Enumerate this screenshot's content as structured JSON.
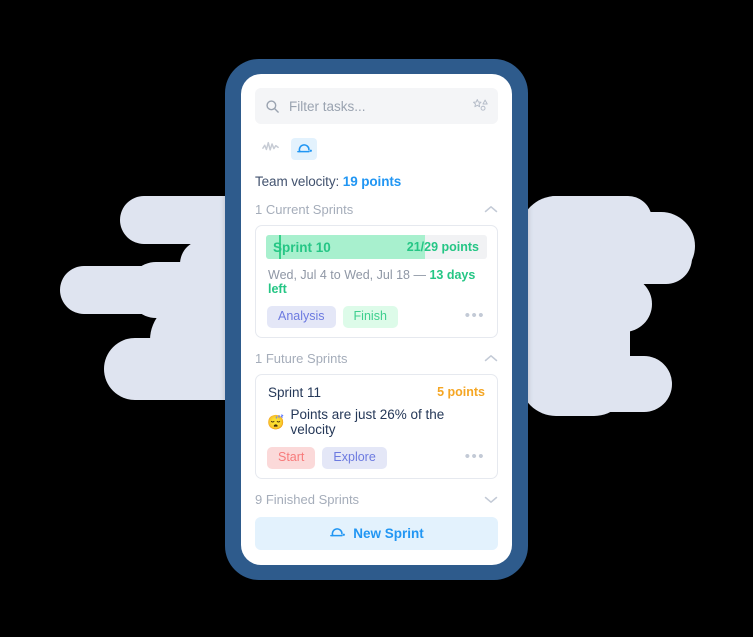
{
  "theme": {
    "frame_color": "#2e5b8c",
    "screen_bg": "#ffffff",
    "cloud_color": "#dfe4f0",
    "accent_blue": "#2196f3",
    "accent_green": "#25c685",
    "accent_orange": "#f5a623",
    "muted_text": "#a5adba",
    "body_text": "#253858"
  },
  "search": {
    "placeholder": "Filter tasks...",
    "value": "",
    "left_icon": "search-icon",
    "right_icon": "magic-stars-icon"
  },
  "view_toggle": {
    "items": [
      {
        "icon": "activity-chart-icon",
        "active": false
      },
      {
        "icon": "sprint-icon",
        "active": true
      }
    ]
  },
  "velocity": {
    "label": "Team velocity:",
    "value": "19 points"
  },
  "sections": [
    {
      "title": "1 Current Sprints",
      "chevron": "chevron-up-icon",
      "expanded": true
    },
    {
      "title": "1 Future Sprints",
      "chevron": "chevron-up-icon",
      "expanded": true
    },
    {
      "title": "9 Finished Sprints",
      "chevron": "chevron-down-icon",
      "expanded": false
    }
  ],
  "current_sprint": {
    "name": "Sprint 10",
    "points": "21/29 points",
    "progress_percent": 72,
    "marker_percent": 6,
    "dates": "Wed, Jul 4 to Wed, Jul 18 —",
    "days_left": "13 days left",
    "tags": [
      {
        "label": "Analysis",
        "style": "lavender"
      },
      {
        "label": "Finish",
        "style": "green"
      }
    ],
    "overflow_icon": "more-options-icon",
    "overflow_label": "•••"
  },
  "future_sprint": {
    "name": "Sprint 11",
    "points": "5 points",
    "note_emoji": "😴",
    "note_text": "Points are just 26% of the velocity",
    "tags": [
      {
        "label": "Start",
        "style": "red"
      },
      {
        "label": "Explore",
        "style": "lavender"
      }
    ],
    "overflow_icon": "more-options-icon",
    "overflow_label": "•••"
  },
  "new_sprint_button": {
    "label": "New Sprint",
    "icon": "sprint-icon"
  }
}
